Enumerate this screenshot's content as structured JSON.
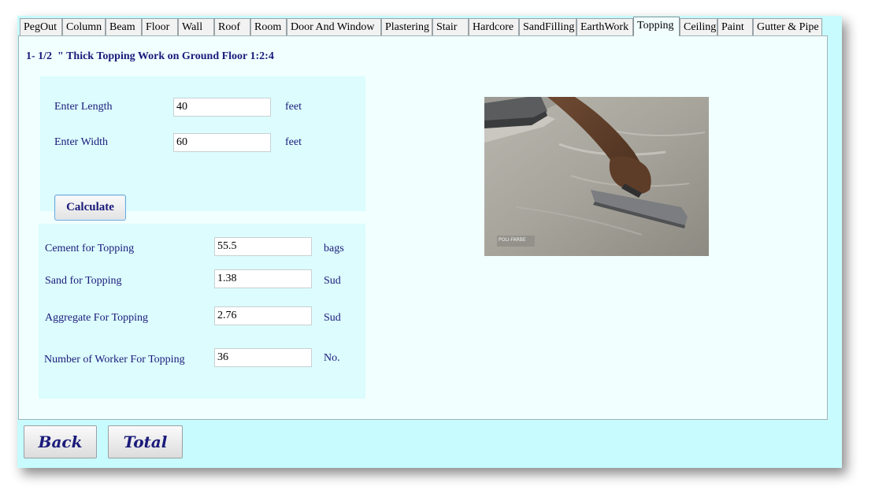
{
  "tabs": [
    "PegOut",
    "Column",
    "Beam",
    "Floor",
    "Wall",
    "Roof",
    "Room",
    "Door And Window",
    "Plastering",
    "Stair",
    "Hardcore",
    "SandFilling",
    "EarthWork",
    "Topping",
    "Ceiling",
    "Paint",
    "Gutter & Pipe"
  ],
  "active_tab": "Topping",
  "heading": "1- 1/2  \" Thick Topping Work on Ground Floor 1:2:4",
  "inputs": {
    "length_label": "Enter Length",
    "length_value": "40",
    "length_unit": "feet",
    "width_label": "Enter Width",
    "width_value": "60",
    "width_unit": "feet",
    "calculate_label": "Calculate"
  },
  "results": {
    "cement_label": "Cement for Topping",
    "cement_value": "55.5",
    "cement_unit": "bags",
    "sand_label": "Sand for Topping",
    "sand_value": "1.38",
    "sand_unit": "Sud",
    "aggregate_label": "Aggregate For Topping",
    "aggregate_value": "2.76",
    "aggregate_unit": "Sud",
    "workers_label": "Number of Worker For Topping",
    "workers_value": "36",
    "workers_unit": "No."
  },
  "photo_watermark": "POLI-FARBE",
  "footer": {
    "back_label": "Back",
    "total_label": "Total"
  }
}
